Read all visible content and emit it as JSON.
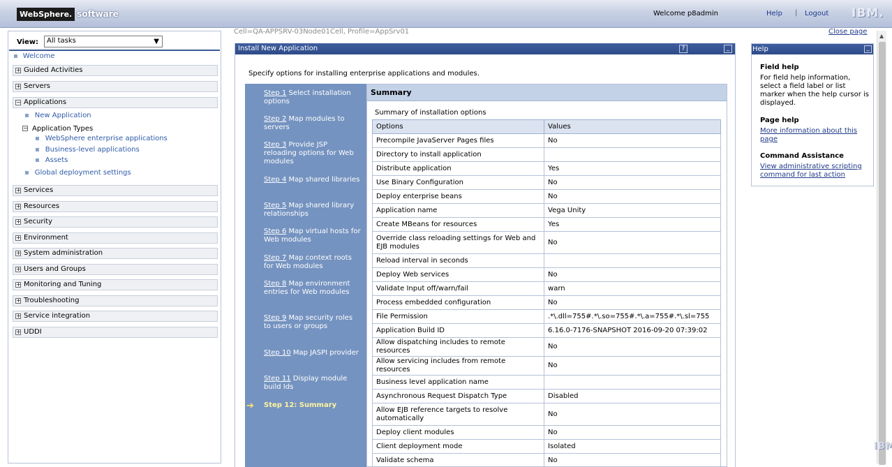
{
  "banner": {
    "brand_primary": "WebSphere.",
    "brand_secondary": "software",
    "welcome": "Welcome p8admin",
    "help": "Help",
    "separator": "|",
    "logout": "Logout",
    "ibm_logo": "IBM."
  },
  "nav": {
    "view_label": "View:",
    "view_value": "All tasks",
    "welcome": "Welcome",
    "categories": [
      "Guided Activities",
      "Servers",
      "Applications",
      "Services",
      "Resources",
      "Security",
      "Environment",
      "System administration",
      "Users and Groups",
      "Monitoring and Tuning",
      "Troubleshooting",
      "Service integration",
      "UDDI"
    ],
    "applications_children": {
      "new_application": "New Application",
      "application_types": "Application Types",
      "types": [
        "WebSphere enterprise applications",
        "Business-level applications",
        "Assets"
      ],
      "global_deployment": "Global deployment settings"
    }
  },
  "context": {
    "cell": "Cell=QA-APPSRV-03Node01Cell, Profile=AppSrv01",
    "close_page": "Close page"
  },
  "main": {
    "title": "Install New Application",
    "help_btn": "?",
    "min_btn": "_",
    "intro": "Specify options for installing enterprise applications and modules.",
    "steps": [
      {
        "link": "Step 1",
        "text": " Select installation options"
      },
      {
        "link": "Step 2",
        "text": " Map modules to servers"
      },
      {
        "link": "Step 3",
        "text": " Provide JSP reloading options for Web modules"
      },
      {
        "link": "Step 4",
        "text": " Map shared libraries"
      },
      {
        "link": "Step 5",
        "text": " Map shared library relationships"
      },
      {
        "link": "Step 6",
        "text": " Map virtual hosts for Web modules"
      },
      {
        "link": "Step 7",
        "text": " Map context roots for Web modules"
      },
      {
        "link": "Step 8",
        "text": " Map environment entries for Web modules"
      },
      {
        "link": "Step 9",
        "text": " Map security roles to users or groups"
      },
      {
        "link": "Step 10",
        "text": " Map JASPI provider"
      },
      {
        "link": "Step 11",
        "text": " Display module build Ids"
      }
    ],
    "current_step": "Step 12: Summary",
    "current_arrow": "➔",
    "summary_title": "Summary",
    "summary_sub": "Summary of installation options",
    "columns": [
      "Options",
      "Values"
    ],
    "rows": [
      {
        "option": "Precompile JavaServer Pages files",
        "value": "No"
      },
      {
        "option": "Directory to install application",
        "value": ""
      },
      {
        "option": "Distribute application",
        "value": "Yes"
      },
      {
        "option": "Use Binary Configuration",
        "value": "No"
      },
      {
        "option": "Deploy enterprise beans",
        "value": "No"
      },
      {
        "option": "Application name",
        "value": "Vega Unity"
      },
      {
        "option": "Create MBeans for resources",
        "value": "Yes"
      },
      {
        "option": "Override class reloading settings for Web and EJB modules",
        "value": "No"
      },
      {
        "option": "Reload interval in seconds",
        "value": ""
      },
      {
        "option": "Deploy Web services",
        "value": "No"
      },
      {
        "option": "Validate Input off/warn/fail",
        "value": "warn"
      },
      {
        "option": "Process embedded configuration",
        "value": "No"
      },
      {
        "option": "File Permission",
        "value": ".*\\.dll=755#.*\\.so=755#.*\\.a=755#.*\\.sl=755"
      },
      {
        "option": "Application Build ID",
        "value": "6.16.0-7176-SNAPSHOT 2016-09-20 07:39:02"
      },
      {
        "option": "Allow dispatching includes to remote resources",
        "value": "No"
      },
      {
        "option": "Allow servicing includes from remote resources",
        "value": "No"
      },
      {
        "option": "Business level application name",
        "value": ""
      },
      {
        "option": "Asynchronous Request Dispatch Type",
        "value": "Disabled"
      },
      {
        "option": "Allow EJB reference targets to resolve automatically",
        "value": "No"
      },
      {
        "option": "Deploy client modules",
        "value": "No"
      },
      {
        "option": "Client deployment mode",
        "value": "Isolated"
      },
      {
        "option": "Validate schema",
        "value": "No"
      }
    ]
  },
  "help": {
    "title": "Help",
    "min_btn": "_",
    "field_help_title": "Field help",
    "field_help_text": "For field help information, select a field label or list marker when the help cursor is displayed.",
    "page_help_title": "Page help",
    "page_help_link": "More information about this page",
    "command_title": "Command Assistance",
    "command_link": "View administrative scripting command for last action"
  },
  "colors": {
    "title_bar": "#2e4b88",
    "wizard_bg": "#7593c0",
    "summary_head": "#c4d2e8",
    "link": "#1f3a8a",
    "current_step": "#fff3a0"
  }
}
